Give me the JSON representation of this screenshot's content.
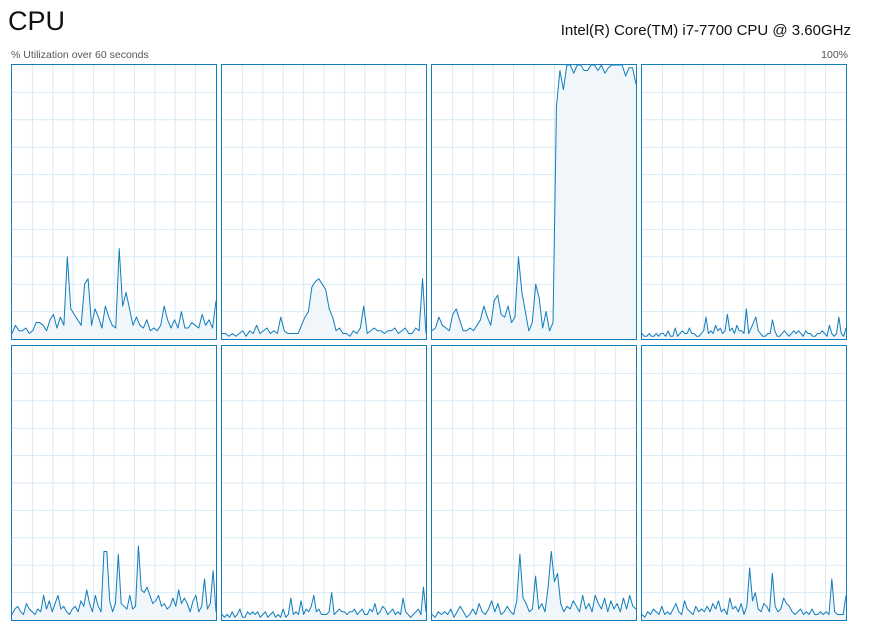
{
  "header": {
    "title": "CPU",
    "processor_name": "Intel(R) Core(TM) i7-7700 CPU @ 3.60GHz",
    "utilization_label": "% Utilization over 60 seconds",
    "max_label": "100%"
  },
  "colors": {
    "line": "#117dbb",
    "fill": "#f1f6fa",
    "grid": "#d9eaf4",
    "border": "#117dbb"
  },
  "chart_data": {
    "type": "area",
    "grid": true,
    "ylim": [
      0,
      100
    ],
    "xlim": [
      0,
      60
    ],
    "cores": [
      {
        "values": [
          2,
          5,
          3,
          3,
          4,
          2,
          3,
          6,
          6,
          5,
          3,
          7,
          9,
          4,
          8,
          5,
          30,
          11,
          9,
          7,
          5,
          20,
          22,
          5,
          11,
          8,
          4,
          12,
          8,
          5,
          4,
          33,
          12,
          17,
          11,
          5,
          8,
          5,
          4,
          7,
          3,
          4,
          3,
          5,
          12,
          7,
          4,
          7,
          4,
          10,
          4,
          4,
          6,
          5,
          4,
          9,
          5,
          7,
          4,
          14
        ]
      },
      {
        "values": [
          2,
          2,
          1,
          2,
          1,
          2,
          3,
          1,
          3,
          2,
          5,
          2,
          3,
          4,
          2,
          3,
          2,
          8,
          3,
          2,
          2,
          2,
          2,
          5,
          8,
          10,
          19,
          21,
          22,
          20,
          18,
          11,
          8,
          3,
          4,
          2,
          2,
          1,
          3,
          2,
          4,
          12,
          2,
          3,
          4,
          3,
          3,
          2,
          3,
          3,
          4,
          2,
          3,
          4,
          2,
          2,
          4,
          3,
          22,
          2
        ]
      },
      {
        "values": [
          3,
          4,
          8,
          5,
          4,
          3,
          9,
          11,
          7,
          3,
          3,
          4,
          3,
          5,
          7,
          12,
          8,
          5,
          14,
          16,
          9,
          8,
          12,
          6,
          8,
          30,
          17,
          10,
          3,
          6,
          20,
          15,
          4,
          10,
          3,
          6,
          85,
          98,
          91,
          100,
          100,
          97,
          100,
          100,
          98,
          98,
          100,
          100,
          98,
          100,
          97,
          99,
          100,
          100,
          100,
          100,
          96,
          99,
          99,
          93
        ]
      },
      {
        "values": [
          2,
          1,
          1,
          2,
          1,
          1,
          2,
          1,
          2,
          2,
          1,
          3,
          1,
          1,
          4,
          1,
          2,
          3,
          2,
          2,
          4,
          2,
          2,
          1,
          1,
          2,
          3,
          8,
          2,
          3,
          2,
          5,
          3,
          4,
          2,
          3,
          9,
          3,
          4,
          2,
          5,
          3,
          3,
          2,
          11,
          2,
          4,
          6,
          8,
          3,
          2,
          1,
          1,
          2,
          2,
          7,
          3,
          1,
          1,
          2,
          3,
          2,
          1,
          2,
          3,
          2,
          3,
          2,
          1,
          3,
          2,
          2,
          1,
          1,
          2,
          2,
          3,
          2,
          1,
          5,
          2,
          1,
          2,
          8,
          2,
          1,
          4
        ]
      },
      {
        "values": [
          2,
          4,
          5,
          3,
          2,
          6,
          4,
          3,
          2,
          4,
          3,
          9,
          4,
          7,
          3,
          6,
          9,
          4,
          5,
          3,
          2,
          4,
          5,
          3,
          7,
          5,
          11,
          6,
          3,
          9,
          5,
          3,
          25,
          25,
          7,
          3,
          6,
          24,
          6,
          5,
          4,
          9,
          4,
          5,
          27,
          11,
          10,
          12,
          9,
          6,
          7,
          9,
          5,
          6,
          4,
          5,
          8,
          5,
          11,
          6,
          8,
          6,
          3,
          7,
          9,
          3,
          5,
          15,
          4,
          6,
          18,
          3
        ]
      },
      {
        "values": [
          2,
          1,
          2,
          1,
          3,
          1,
          2,
          4,
          1,
          1,
          3,
          2,
          3,
          2,
          3,
          1,
          2,
          3,
          1,
          2,
          3,
          1,
          2,
          1,
          4,
          1,
          2,
          8,
          2,
          3,
          2,
          7,
          2,
          4,
          3,
          5,
          9,
          3,
          4,
          2,
          2,
          2,
          3,
          10,
          2,
          3,
          4,
          3,
          3,
          2,
          3,
          3,
          4,
          2,
          3,
          4,
          2,
          2,
          4,
          3,
          6,
          2,
          3,
          5,
          4,
          2,
          3,
          4,
          2,
          3,
          2,
          8,
          3,
          2,
          1,
          2,
          3,
          4,
          2,
          12,
          3
        ]
      },
      {
        "values": [
          2,
          1,
          3,
          2,
          3,
          2,
          4,
          1,
          3,
          5,
          3,
          1,
          2,
          4,
          2,
          6,
          3,
          2,
          4,
          7,
          3,
          6,
          2,
          3,
          5,
          3,
          2,
          7,
          24,
          8,
          6,
          3,
          4,
          16,
          4,
          6,
          3,
          12,
          25,
          14,
          17,
          6,
          3,
          5,
          4,
          7,
          5,
          3,
          9,
          4,
          6,
          3,
          9,
          6,
          4,
          8,
          3,
          7,
          4,
          6,
          3,
          8,
          4,
          9,
          5,
          4
        ]
      },
      {
        "values": [
          2,
          1,
          3,
          2,
          4,
          3,
          2,
          5,
          2,
          3,
          2,
          4,
          6,
          3,
          2,
          7,
          4,
          3,
          2,
          5,
          3,
          4,
          3,
          5,
          3,
          6,
          4,
          7,
          3,
          4,
          2,
          8,
          4,
          5,
          3,
          6,
          2,
          5,
          19,
          7,
          10,
          4,
          3,
          6,
          5,
          3,
          17,
          5,
          3,
          4,
          8,
          6,
          5,
          3,
          2,
          3,
          4,
          2,
          3,
          2,
          4,
          2,
          2,
          3,
          2,
          3,
          2,
          15,
          3,
          2,
          2,
          2,
          9
        ]
      }
    ]
  }
}
